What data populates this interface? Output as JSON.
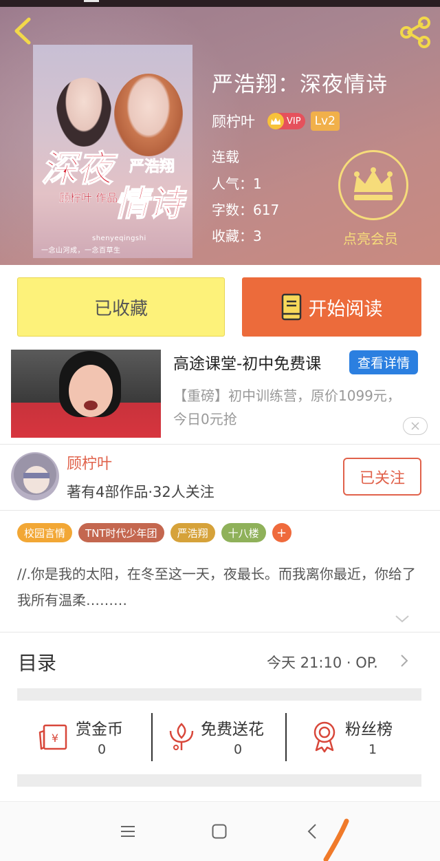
{
  "book": {
    "title": "严浩翔：深夜情诗",
    "author": "顾柠叶",
    "vip_label": "VIP",
    "level": "Lv2",
    "status": "连载",
    "popularity": "人气：1",
    "word_count": "字数：617",
    "favorites": "收藏：3",
    "cover": {
      "title_line1": "深夜",
      "title_line2": "情诗",
      "subtitle_name": "严浩翔",
      "byline": "顾柠叶 作品",
      "url": "shenyeqingshi",
      "tagline": "一念山河成，一念百草生"
    }
  },
  "member": {
    "label": "点亮会员"
  },
  "actions": {
    "favorited": "已收藏",
    "start_reading": "开始阅读"
  },
  "ad": {
    "title": "高途课堂-初中免费课",
    "detail_button": "查看详情",
    "description": "【重磅】初中训练营，原价1099元，今日0元抢"
  },
  "writer": {
    "name": "顾柠叶",
    "stats": "著有4部作品·32人关注",
    "follow_button": "已关注"
  },
  "tags": [
    {
      "label": "校园言情",
      "color": "#f2a735"
    },
    {
      "label": "TNT时代少年团",
      "color": "#c4674f"
    },
    {
      "label": "严浩翔",
      "color": "#d6a23a"
    },
    {
      "label": "十八楼",
      "color": "#8fb15a"
    }
  ],
  "tag_more": "+",
  "synopsis": "//.你是我的太阳，在冬至这一天，夜最长。而我离你最近，你给了我所有温柔………",
  "toc": {
    "label": "目录",
    "latest": "今天 21:10 · OP."
  },
  "support": [
    {
      "label": "赏金币",
      "count": "0",
      "icon": "coin-icon"
    },
    {
      "label": "免费送花",
      "count": "0",
      "icon": "flower-icon"
    },
    {
      "label": "粉丝榜",
      "count": "1",
      "icon": "medal-icon"
    }
  ],
  "colors": {
    "accent": "#ec6b3b",
    "favorite_bg": "#fdf27a",
    "writer_red": "#e0614a",
    "gold": "#f6dc7a",
    "ad_blue": "#2b7fe0"
  }
}
